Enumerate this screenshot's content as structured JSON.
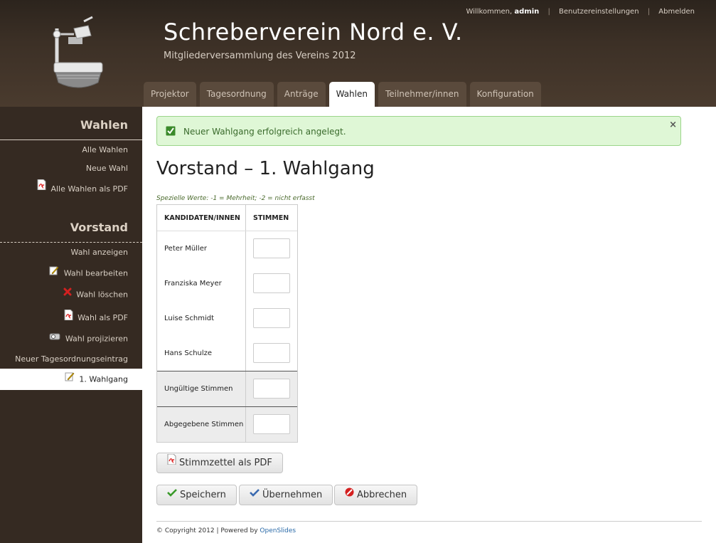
{
  "header": {
    "title": "Schreberverein Nord e. V.",
    "subtitle": "Mitgliederversammlung des Vereins 2012",
    "welcome_prefix": "Willkommen,",
    "username": "admin",
    "user_settings": "Benutzereinstellungen",
    "logout": "Abmelden",
    "separator": "|"
  },
  "tabs": [
    {
      "label": "Projektor",
      "active": false
    },
    {
      "label": "Tagesordnung",
      "active": false
    },
    {
      "label": "Anträge",
      "active": false
    },
    {
      "label": "Wahlen",
      "active": true
    },
    {
      "label": "Teilnehmer/innen",
      "active": false
    },
    {
      "label": "Konfiguration",
      "active": false
    }
  ],
  "sidebar": {
    "section1_title": "Wahlen",
    "section1_items": [
      {
        "label": "Alle Wahlen",
        "icon": "none"
      },
      {
        "label": "Neue Wahl",
        "icon": "none"
      },
      {
        "label": "Alle Wahlen als PDF",
        "icon": "pdf-icon"
      }
    ],
    "section2_title": "Vorstand",
    "section2_items": [
      {
        "label": "Wahl anzeigen",
        "icon": "none"
      },
      {
        "label": "Wahl bearbeiten",
        "icon": "edit-icon"
      },
      {
        "label": "Wahl löschen",
        "icon": "delete-icon"
      },
      {
        "label": "Wahl als PDF",
        "icon": "pdf-icon"
      },
      {
        "label": "Wahl projizieren",
        "icon": "projector-icon"
      },
      {
        "label": "Neuer Tagesordnungseintrag",
        "icon": "none"
      }
    ],
    "active_item": {
      "label": "1. Wahlgang",
      "icon": "edit-icon"
    }
  },
  "alert": {
    "message": "Neuer Wahlgang erfolgreich angelegt.",
    "close": "×",
    "color": "#dff7d6"
  },
  "main": {
    "title": "Vorstand – 1. Wahlgang",
    "hint": "Spezielle Werte: -1 = Mehrheit; -2 = nicht erfasst",
    "table": {
      "col_candidates": "KANDIDATEN/INNEN",
      "col_votes": "STIMMEN",
      "candidates": [
        "Peter Müller",
        "Franziska Meyer",
        "Luise Schmidt",
        "Hans Schulze"
      ],
      "invalid_label": "Ungültige Stimmen",
      "cast_label": "Abgegebene Stimmen"
    },
    "buttons": {
      "pdf": "Stimmzettel als PDF",
      "save": "Speichern",
      "apply": "Übernehmen",
      "cancel": "Abbrechen"
    }
  },
  "footer": {
    "text": "© Copyright 2012 | Powered by",
    "link": "OpenSlides"
  }
}
